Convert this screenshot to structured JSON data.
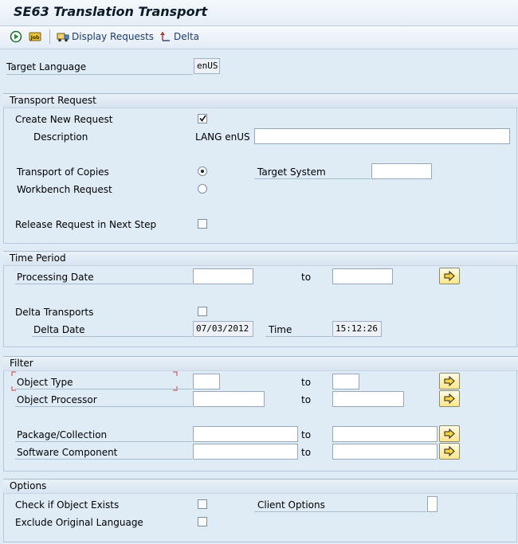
{
  "window": {
    "title": "SE63 Translation Transport"
  },
  "toolbar": {
    "execute_icon": "execute-icon",
    "job_icon": "background-job-icon",
    "display_requests_icon": "transport-truck-icon",
    "display_requests_label": "Display Requests",
    "delta_icon": "delta-icon",
    "delta_label": "Delta"
  },
  "target_language": {
    "label": "Target Language",
    "value": "enUS"
  },
  "transport_request": {
    "title": "Transport Request",
    "create_new_label": "Create New Request",
    "create_new_checked": true,
    "description_label": "Description",
    "description_prefix": "LANG enUS",
    "description_value": "",
    "transport_of_copies_label": "Transport of Copies",
    "transport_of_copies_selected": true,
    "target_system_label": "Target System",
    "target_system_value": "",
    "workbench_label": "Workbench Request",
    "workbench_selected": false,
    "release_label": "Release Request in Next Step",
    "release_checked": false
  },
  "time_period": {
    "title": "Time Period",
    "processing_date_label": "Processing Date",
    "processing_date_from": "",
    "to_label": "to",
    "processing_date_to": "",
    "delta_transports_label": "Delta Transports",
    "delta_transports_checked": false,
    "delta_date_label": "Delta Date",
    "delta_date_value": "07/03/2012",
    "time_label": "Time",
    "time_value": "15:12:26"
  },
  "filter": {
    "title": "Filter",
    "to_label": "to",
    "object_type_label": "Object Type",
    "object_processor_label": "Object Processor",
    "package_label": "Package/Collection",
    "software_component_label": "Software Component"
  },
  "options": {
    "title": "Options",
    "check_exists_label": "Check if Object Exists",
    "check_exists_checked": false,
    "exclude_original_label": "Exclude Original Language",
    "exclude_original_checked": false,
    "client_options_label": "Client Options",
    "client_options_value": ""
  },
  "colors": {
    "background": "#dfebf5",
    "multi_select_button": "#ffe68a",
    "title_text": "#0c1a2a",
    "link_text": "#1f3c6e"
  }
}
